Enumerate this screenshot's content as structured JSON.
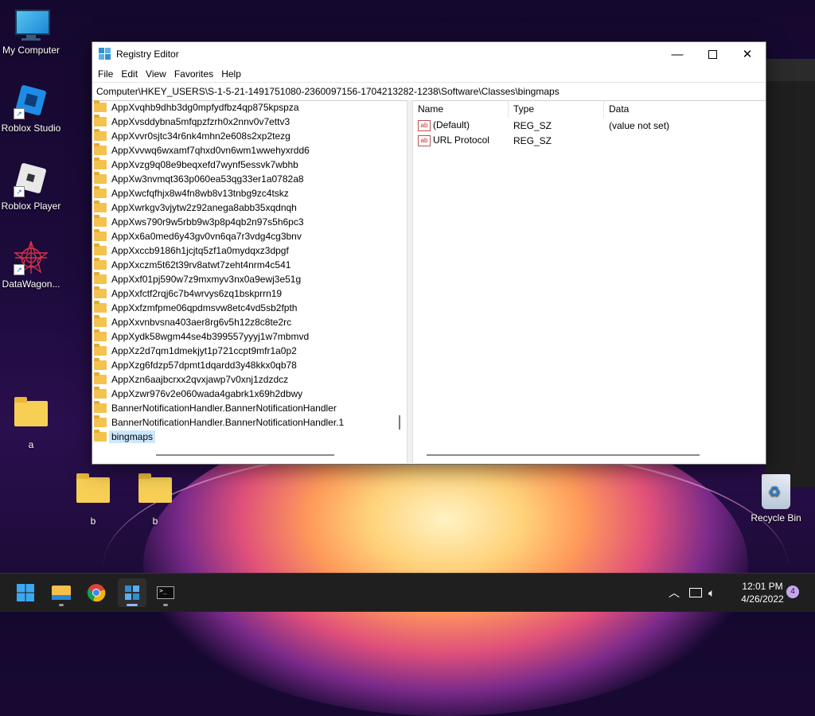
{
  "desktop": {
    "icons": [
      {
        "label": "My Computer"
      },
      {
        "label": "Roblox Studio"
      },
      {
        "label": "Roblox Player"
      },
      {
        "label": "DataWagon..."
      },
      {
        "label": "a"
      },
      {
        "label": "b"
      },
      {
        "label": "b"
      },
      {
        "label": "Recycle Bin"
      }
    ]
  },
  "window": {
    "title": "Registry Editor",
    "menu": [
      "File",
      "Edit",
      "View",
      "Favorites",
      "Help"
    ],
    "address": "Computer\\HKEY_USERS\\S-1-5-21-1491751080-2360097156-1704213282-1238\\Software\\Classes\\bingmaps",
    "tree": [
      "AppXvqhb9dhb3dg0mpfydfbz4qp875kpspza",
      "AppXvsddybna5mfqpzfzrh0x2nnv0v7ettv3",
      "AppXvvr0sjtc34r6nk4mhn2e608s2xp2tezg",
      "AppXvvwq6wxamf7qhxd0vn6wm1wwehyxrdd6",
      "AppXvzg9q08e9beqxefd7wynf5essvk7wbhb",
      "AppXw3nvmqt363p060ea53qg33er1a0782a8",
      "AppXwcfqfhjx8w4fn8wb8v13tnbg9zc4tskz",
      "AppXwrkgv3vjytw2z92anega8abb35xqdnqh",
      "AppXws790r9w5rbb9w3p8p4qb2n97s5h6pc3",
      "AppXx6a0med6y43gv0vn6qa7r3vdg4cg3bnv",
      "AppXxccb9186h1jcjtq5zf1a0mydqxz3dpgf",
      "AppXxczm5t62t39rv8atwt7zeht4nrm4c541",
      "AppXxf01pj590w7z9mxmyv3nx0a9ewj3e51g",
      "AppXxfctf2rqj6c7b4wrvys6zq1bskprrn19",
      "AppXxfzmfpme06qpdmsvw8etc4vd5sb2fpth",
      "AppXxvnbvsna403aer8rg6v5h12z8c8te2rc",
      "AppXydk58wgm44se4b399557yyyj1w7mbmvd",
      "AppXz2d7qm1dmekjyt1p721ccpt9mfr1a0p2",
      "AppXzg6fdzp57dpmt1dqardd3y48kkx0qb78",
      "AppXzn6aajbcrxx2qvxjawp7v0xnj1zdzdcz",
      "AppXzwr976v2e060wada4gabrk1x69h2dbwy",
      "BannerNotificationHandler.BannerNotificationHandler",
      "BannerNotificationHandler.BannerNotificationHandler.1",
      "bingmaps"
    ],
    "selected_key": "bingmaps",
    "columns": {
      "name": "Name",
      "type": "Type",
      "data": "Data"
    },
    "values": [
      {
        "name": "(Default)",
        "type": "REG_SZ",
        "data": "(value not set)"
      },
      {
        "name": "URL Protocol",
        "type": "REG_SZ",
        "data": ""
      }
    ]
  },
  "taskbar": {
    "time": "12:01 PM",
    "date": "4/26/2022",
    "notifications": "4"
  },
  "colors": {
    "selection": "#cce8ff",
    "folder": "#f4c24f",
    "taskbar": "#1f1f1f"
  }
}
